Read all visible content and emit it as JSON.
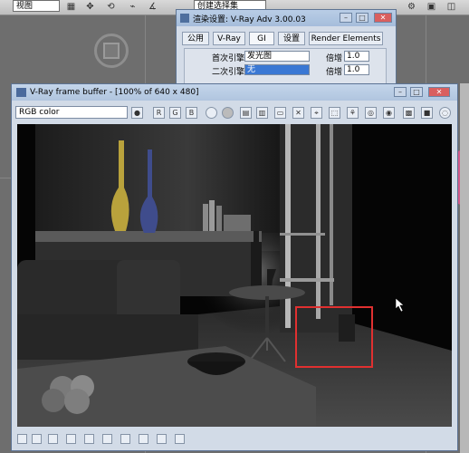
{
  "max_toolbar": {
    "view_dropdown": "视图",
    "selection_set": "创建选择集"
  },
  "render_settings": {
    "title": "渲染设置: V-Ray Adv 3.00.03",
    "tabs": [
      "公用",
      "V-Ray",
      "GI",
      "设置",
      "Render Elements"
    ],
    "active_tab": "GI",
    "primary_engine_label": "首次引擎",
    "primary_engine_value": "发光图",
    "secondary_engine_label": "二次引擎",
    "secondary_engine_value": "无",
    "multiplier_label": "倍增",
    "primary_multiplier": "1.0",
    "secondary_multiplier": "1.0"
  },
  "vfb": {
    "title": "V-Ray frame buffer - [100% of 640 x 480]",
    "channel": "RGB color"
  },
  "colors": {
    "highlight_box": "#e03030",
    "vase_yellow": "#b9a23c",
    "vase_blue": "#3f4c8c"
  }
}
